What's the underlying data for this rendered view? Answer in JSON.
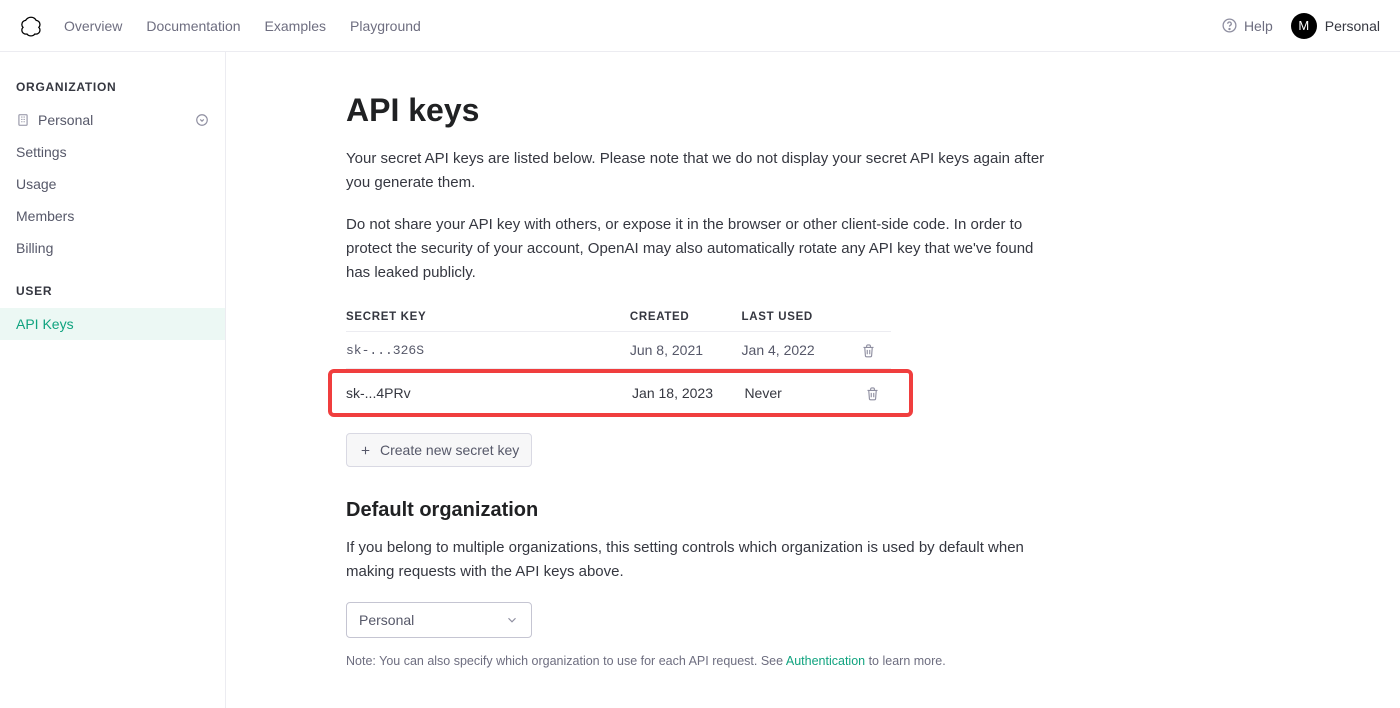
{
  "header": {
    "nav": {
      "overview": "Overview",
      "documentation": "Documentation",
      "examples": "Examples",
      "playground": "Playground"
    },
    "help": "Help",
    "avatar_initial": "M",
    "account_name": "Personal"
  },
  "sidebar": {
    "org_label": "ORGANIZATION",
    "org_name": "Personal",
    "items": {
      "settings": "Settings",
      "usage": "Usage",
      "members": "Members",
      "billing": "Billing"
    },
    "user_label": "USER",
    "user_items": {
      "api_keys": "API Keys"
    }
  },
  "page": {
    "title": "API keys",
    "intro1": "Your secret API keys are listed below. Please note that we do not display your secret API keys again after you generate them.",
    "intro2": "Do not share your API key with others, or expose it in the browser or other client-side code. In order to protect the security of your account, OpenAI may also automatically rotate any API key that we've found has leaked publicly.",
    "columns": {
      "secret": "SECRET KEY",
      "created": "CREATED",
      "last_used": "LAST USED"
    },
    "rows": [
      {
        "secret": "sk-...326S",
        "created": "Jun 8, 2021",
        "last_used": "Jan 4, 2022"
      },
      {
        "secret": "sk-...4PRv",
        "created": "Jan 18, 2023",
        "last_used": "Never"
      }
    ],
    "create_label": "Create new secret key",
    "default_org_heading": "Default organization",
    "default_org_text": "If you belong to multiple organizations, this setting controls which organization is used by default when making requests with the API keys above.",
    "default_org_selected": "Personal",
    "note_prefix": "Note: You can also specify which organization to use for each API request. See ",
    "note_link": "Authentication",
    "note_suffix": " to learn more."
  }
}
